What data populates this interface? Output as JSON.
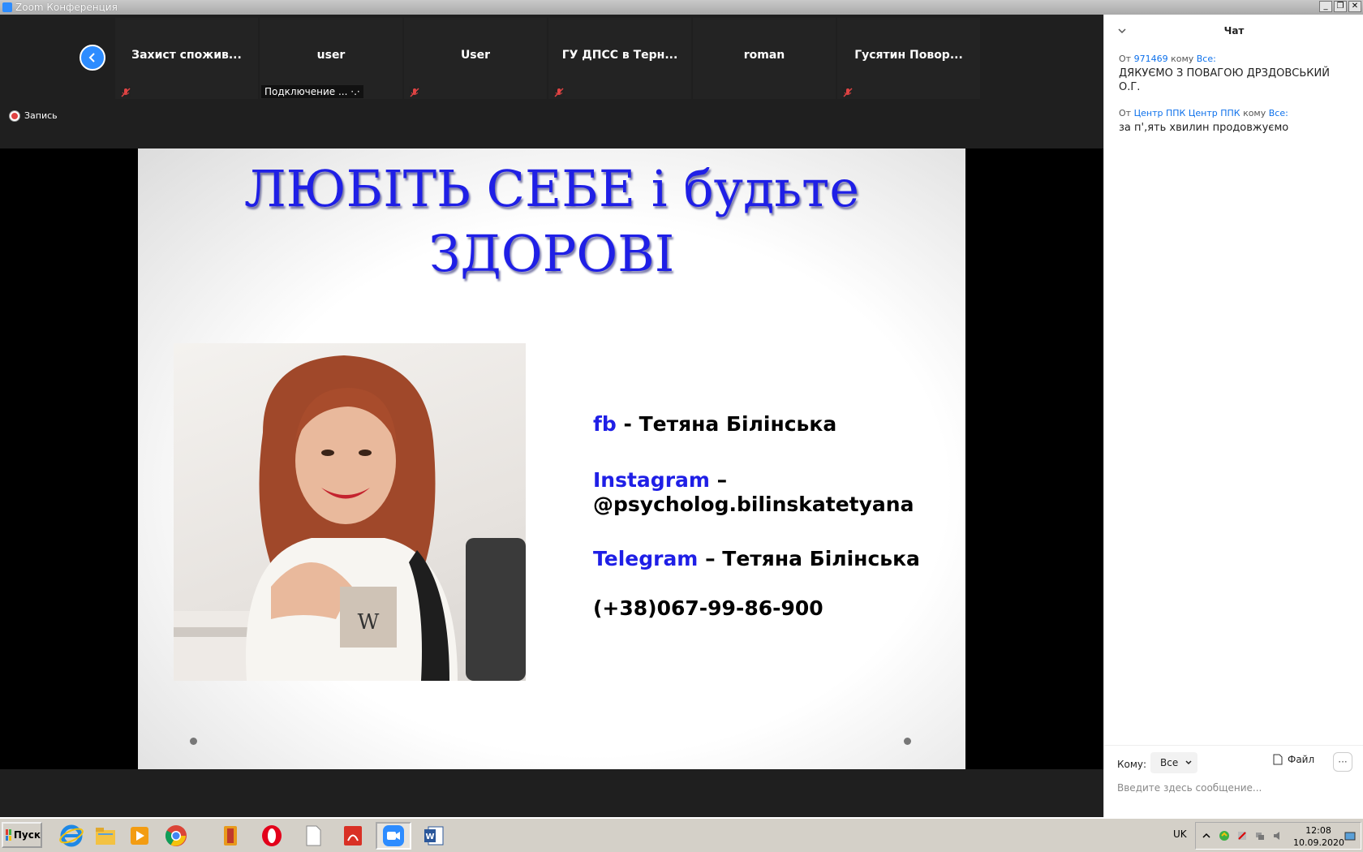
{
  "window": {
    "title": "Zoom Конференция"
  },
  "gallery": {
    "participants": [
      {
        "name": "Захист спожив...",
        "muted": true
      },
      {
        "name": "user",
        "status": "Подключение ... ·.·"
      },
      {
        "name": "User",
        "muted": true
      },
      {
        "name": "ГУ ДПСС в Терн...",
        "muted": true
      },
      {
        "name": "roman",
        "muted": false
      },
      {
        "name": "Гусятин Повор...",
        "muted": true
      }
    ],
    "recording_label": "Запись"
  },
  "slide": {
    "title_line1": "ЛЮБІТЬ СЕБЕ і будьте",
    "title_line2": "ЗДОРОВІ",
    "fb_label": "fb",
    "fb_text": " - Тетяна Білінська",
    "instagram_label": "Instagram",
    "instagram_dash": " –",
    "instagram_handle": "@psycholog.bilinskatetyana",
    "telegram_label": "Telegram",
    "telegram_text": " – Тетяна Білінська",
    "phone": "(+38)067-99-86-900"
  },
  "chat": {
    "title": "Чат",
    "messages": [
      {
        "from_prefix": "От",
        "from": "971469",
        "to_prefix": "кому",
        "to": "Все:",
        "text": "ДЯКУЄМО З ПОВАГОЮ ДРЗДОВСЬКИЙ О.Г."
      },
      {
        "from_prefix": "От",
        "from": "Центр ППК Центр ППК",
        "to_prefix": "кому",
        "to": "Все:",
        "text": "за п',ять хвилин продовжуємо"
      }
    ],
    "to_label": "Кому:",
    "to_value": "Все",
    "file_label": "Файл",
    "more_label": "···",
    "input_placeholder": "Введите здесь сообщение..."
  },
  "taskbar": {
    "start_label": "Пуск",
    "language": "UK",
    "time": "12:08",
    "date": "10.09.2020"
  },
  "colors": {
    "zoom_blue": "#2d8cff",
    "slide_title_blue": "#1f1fe6",
    "chat_link_blue": "#0e71eb"
  }
}
